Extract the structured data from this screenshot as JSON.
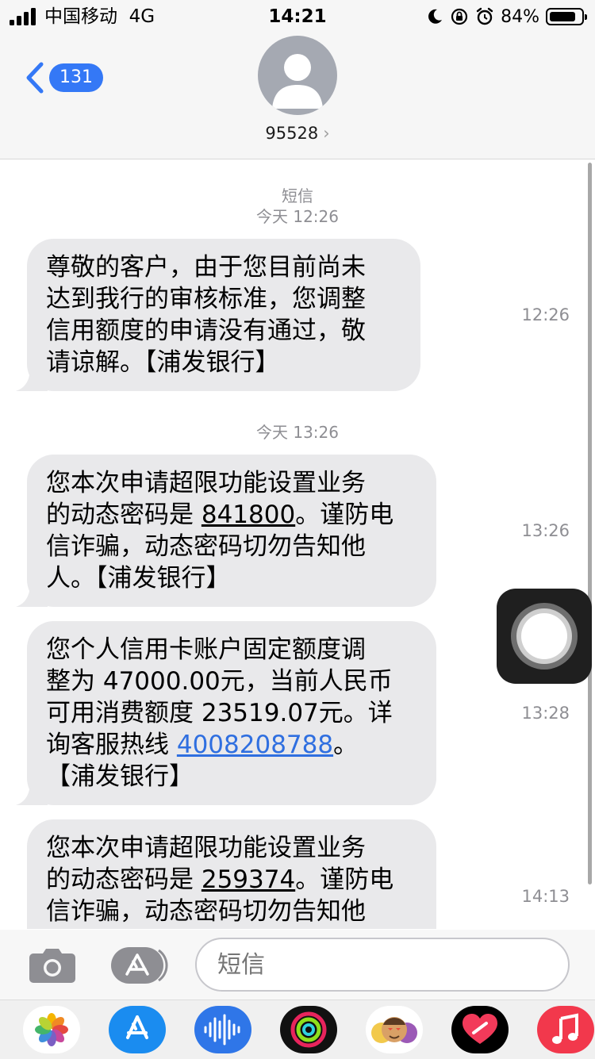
{
  "status_bar": {
    "carrier": "中国移动",
    "network": "4G",
    "time": "14:21",
    "battery_percent": "84%",
    "battery_level": 0.84
  },
  "header": {
    "back_count": "131",
    "contact_name": "95528",
    "chevron": "›",
    "accent_color": "#3478f6"
  },
  "thread": {
    "channel_label": "短信",
    "date_1": "今天 12:26",
    "date_2": "今天 13:26",
    "messages": [
      {
        "text": "尊敬的客户，由于您目前尚未达到我行的审核标准，您调整信用额度的申请没有通过，敬请谅解。【浦发银行】",
        "lines": [
          "尊敬的客户，由于您目前尚未",
          "达到我行的审核标准，您调整",
          "信用额度的申请没有通过，敬",
          "请谅解。【浦发银行】"
        ],
        "time": "12:26"
      },
      {
        "line1": "您本次申请超限功能设置业务",
        "line2_pre": "的动态密码是 ",
        "code": "841800",
        "line2_post": "。谨防电",
        "line3": "信诈骗，动态密码切勿告知他",
        "line4": "人。【浦发银行】",
        "time": "13:26"
      },
      {
        "line1": "您个人信用卡账户固定额度调",
        "line2": "整为 47000.00元，当前人民币",
        "line3": "可用消费额度 23519.07元。详",
        "line4_pre": "询客服热线 ",
        "phone": "4008208788",
        "line4_post": "。",
        "line5": "【浦发银行】",
        "time": "13:28"
      },
      {
        "line1": "您本次申请超限功能设置业务",
        "line2_pre": "的动态密码是 ",
        "code": "259374",
        "line2_post": "。谨防电",
        "line3": "信诈骗，动态密码切勿告知他",
        "time": "14:13"
      }
    ]
  },
  "composer": {
    "placeholder": "短信",
    "camera_icon": "camera-icon",
    "apps_icon": "app-store-icon"
  },
  "app_tray": [
    "photos-icon",
    "app-store-icon",
    "audio-icon",
    "activity-icon",
    "memoji-icon",
    "heart-digital-touch-icon",
    "music-icon"
  ]
}
